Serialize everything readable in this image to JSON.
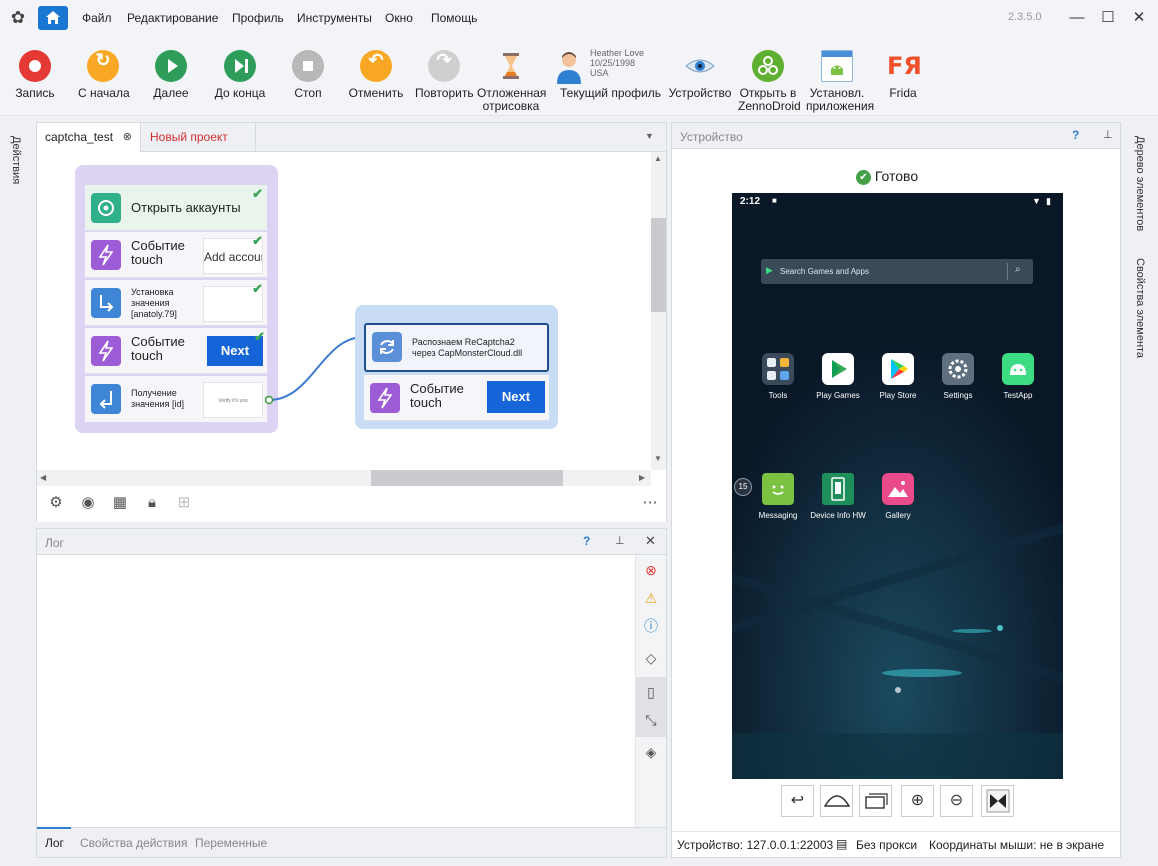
{
  "menubar": {
    "items": [
      "Файл",
      "Редактирование",
      "Профиль",
      "Инструменты",
      "Окно",
      "Помощь"
    ],
    "version": "2.3.5.0"
  },
  "toolbar": {
    "buttons": [
      {
        "label": "Запись",
        "icon": "record-icon",
        "color": "#e53935"
      },
      {
        "label": "С начала",
        "icon": "restart-icon",
        "color": "#f9a825"
      },
      {
        "label": "Далее",
        "icon": "play-icon",
        "color": "#2e9d5a"
      },
      {
        "label": "До конца",
        "icon": "skip-end-icon",
        "color": "#2e9d5a"
      },
      {
        "label": "Стоп",
        "icon": "stop-icon",
        "color": "#b8b8b8"
      },
      {
        "label": "Отменить",
        "icon": "undo-icon",
        "color": "#f9a825"
      },
      {
        "label": "Повторить",
        "icon": "redo-icon",
        "color": "#cfcfcf"
      }
    ],
    "deferred": {
      "line1": "Отложенная",
      "line2": "отрисовка"
    },
    "profile": {
      "name": "Heather Love",
      "date": "10/25/1998",
      "country": "USA",
      "label": "Текущий профиль"
    },
    "device": {
      "label": "Устройство"
    },
    "open_zd": {
      "line1": "Открыть в",
      "line2": "ZennoDroid"
    },
    "installed": {
      "line1": "Установл.",
      "line2": "приложения"
    },
    "frida": {
      "logo": "FЯ",
      "label": "Frida"
    }
  },
  "sidebars": {
    "left": "Действия",
    "right1": "Дерево элементов",
    "right2": "Свойства элемента"
  },
  "editor": {
    "tabs": [
      {
        "label": "captcha_test"
      },
      {
        "label": "Новый проект"
      }
    ],
    "group1": [
      {
        "line1": "Открыть аккаунты",
        "line2": ""
      },
      {
        "line1": "Событие",
        "line2": "touch",
        "preview": "Add accour"
      },
      {
        "line1": "Установка",
        "line2": "значения",
        "line3": "[anatoly.79]"
      },
      {
        "line1": "Событие",
        "line2": "touch",
        "preview": "Next"
      },
      {
        "line1": "Получение",
        "line2": "значения [id]",
        "preview": "Verify it's you"
      }
    ],
    "group2": [
      {
        "line1": "Распознаем ReCaptcha2",
        "line2": "через CapMonsterCloud.dll"
      },
      {
        "line1": "Событие",
        "line2": "touch",
        "preview": "Next"
      }
    ]
  },
  "log": {
    "title": "Лог",
    "tabs": [
      "Лог",
      "Свойства действия",
      "Переменные"
    ]
  },
  "device_panel": {
    "title": "Устройство",
    "status": "Готово",
    "phone": {
      "time": "2:12",
      "search_placeholder": "Search Games and Apps",
      "badge": "15",
      "apps_row1": [
        {
          "label": "Tools",
          "color": "#3b4a5a"
        },
        {
          "label": "Play Games",
          "color": "#ffffff"
        },
        {
          "label": "Play Store",
          "color": "#ffffff"
        },
        {
          "label": "Settings",
          "color": "#5f6f80"
        },
        {
          "label": "TestApp",
          "color": "#3ddc84"
        }
      ],
      "apps_row2": [
        {
          "label": "Messaging",
          "color": "#7cc242"
        },
        {
          "label": "Device Info HW",
          "color": "#1e8e5a"
        },
        {
          "label": "Gallery",
          "color": "#e84a8a"
        }
      ]
    },
    "status_bar": {
      "device": "Устройство: 127.0.0.1:22003",
      "proxy": "Без прокси",
      "mouse": "Координаты мыши: не в экране"
    }
  }
}
